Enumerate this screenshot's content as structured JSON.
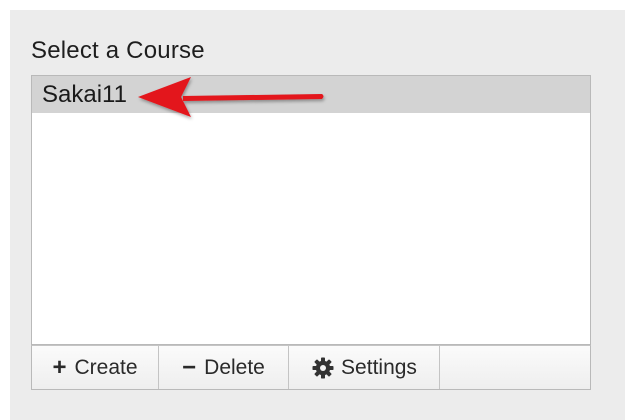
{
  "heading": "Select a Course",
  "courses": [
    {
      "label": "Sakai11",
      "selected": true
    }
  ],
  "toolbar": {
    "create_label": "Create",
    "create_icon": "plus",
    "delete_label": "Delete",
    "delete_icon": "minus",
    "settings_label": "Settings",
    "settings_icon": "gear-icon"
  },
  "annotation": {
    "arrow_color": "#e3141b"
  }
}
